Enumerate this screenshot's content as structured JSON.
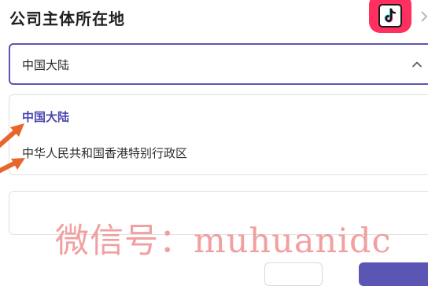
{
  "header": {
    "title": "公司主体所在地",
    "app_icon": "tiktok-logo-icon",
    "app_icon_color": "#ff2f5f"
  },
  "select": {
    "value": "中国大陆",
    "expanded": true,
    "border_color": "#5b55b3",
    "chevron_icon": "chevron-up-icon"
  },
  "dropdown": {
    "options": [
      {
        "label": "中国大陆",
        "selected": true
      },
      {
        "label": "中华人民共和国香港特别行政区",
        "selected": false
      }
    ],
    "selected_color": "#4b45b0"
  },
  "annotation": {
    "arrow_color": "#e8662b",
    "arrow_count": 2
  },
  "watermark": {
    "text": "微信号：muhuanidc",
    "color": "#f08f8f"
  }
}
